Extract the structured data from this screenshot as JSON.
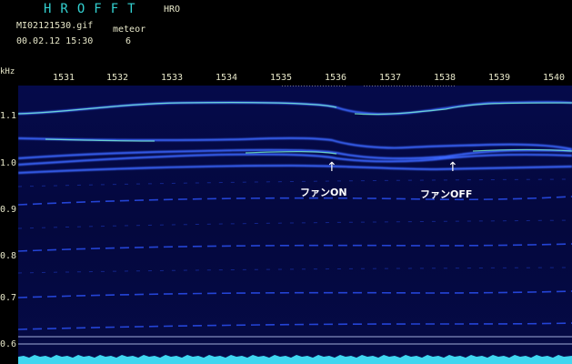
{
  "header": {
    "title": "HROFFT",
    "mode": "HRO",
    "filename": "MI02121530.gif",
    "label": "meteor",
    "datetime": "00.02.12 15:30",
    "count": "6"
  },
  "axis": {
    "y_unit": "kHz",
    "y_ticks": [
      "1.1",
      "1.0",
      "0.9",
      "0.8",
      "0.7",
      "0.6"
    ],
    "x_ticks": [
      "1531",
      "1532",
      "1533",
      "1534",
      "1535",
      "1536",
      "1537",
      "1538",
      "1539",
      "1540"
    ]
  },
  "annotations": {
    "fan_on": "ファンON",
    "fan_off": "ファンOFF"
  },
  "colors": {
    "header_title": "#33d1d1",
    "text": "#e6e6c8",
    "background": "#050a4a",
    "signal": "#3a66ff",
    "signal_bright": "#7fffd0",
    "noise": "#3fd6f0"
  }
}
